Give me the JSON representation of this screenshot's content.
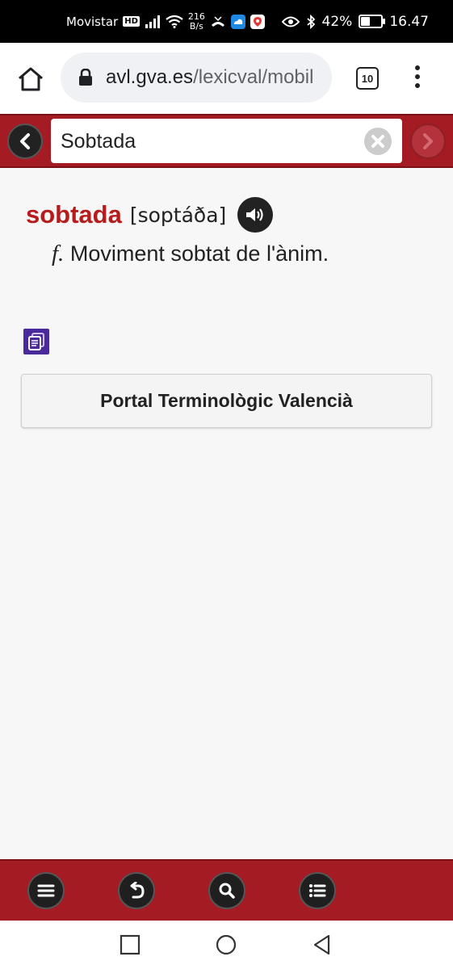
{
  "status_bar": {
    "carrier": "Movistar",
    "hd_badge": "HD",
    "speed_value": "216",
    "speed_unit": "B/s",
    "battery": "42%",
    "battery_level": 0.42,
    "time": "16.47"
  },
  "browser": {
    "url_host": "avl.gva.es",
    "url_path": "/lexicval/mobil",
    "tab_count": "10"
  },
  "search": {
    "value": "Sobtada"
  },
  "entry": {
    "headword": "sobtada",
    "phonetic": "[soptáða]",
    "grammar": "f.",
    "definition": "Moviment sobtat de l'ànim."
  },
  "portal": {
    "label": "Portal Terminològic Valencià"
  },
  "colors": {
    "header_red": "#a51b23",
    "headword_red": "#b71c1c",
    "copy_icon_purple": "#4a2a9b"
  },
  "icons": {
    "home": "home-icon",
    "lock": "lock-icon",
    "back": "chevron-left-icon",
    "forward": "chevron-right-icon",
    "clear": "clear-icon",
    "audio": "speaker-icon",
    "copy": "copy-icon",
    "menu": "hamburger-menu-icon",
    "undo": "undo-icon",
    "search": "search-icon",
    "list": "list-icon"
  }
}
